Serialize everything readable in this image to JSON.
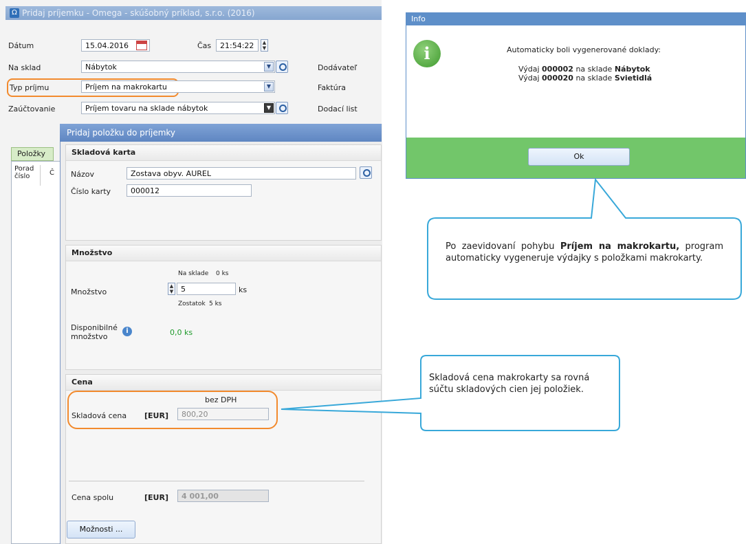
{
  "main": {
    "title": "Pridaj príjemku - Omega - skúšobný príklad, s.r.o. (2016)",
    "date_label": "Dátum",
    "date_value": "15.04.2016",
    "time_label": "Čas",
    "time_value": "21:54:22",
    "warehouse_label": "Na sklad",
    "warehouse_value": "Nábytok",
    "supplier_label": "Dodávateľ",
    "receipt_type_label": "Typ príjmu",
    "receipt_type_value": "Príjem na makrokartu",
    "invoice_label": "Faktúra",
    "posting_label": "Zaúčtovanie",
    "posting_value": "Príjem tovaru na sklade nábytok",
    "delivery_note_label": "Dodací list",
    "tab_items": "Položky",
    "col_order_1": "Porad",
    "col_order_2": "číslo",
    "col_c": "Č"
  },
  "dialog": {
    "title": "Pridaj položku do príjemky",
    "card_section": "Skladová karta",
    "name_label": "Názov",
    "name_value": "Zostava obyv. AUREL",
    "card_no_label": "Číslo karty",
    "card_no_value": "000012",
    "qty_section": "Množstvo",
    "in_stock_label": "Na sklade",
    "in_stock_value": "0 ks",
    "qty_label": "Množstvo",
    "qty_value": "5",
    "qty_unit": "ks",
    "remaining_label": "Zostatok",
    "remaining_value": "5 ks",
    "available_label_1": "Disponibilné",
    "available_label_2": "množstvo",
    "available_value": "0,0 ks",
    "price_section": "Cena",
    "without_vat": "bez DPH",
    "stock_price_label": "Skladová cena",
    "currency": "[EUR]",
    "stock_price_value": "800,20",
    "total_label": "Cena spolu",
    "total_value": "4 001,00",
    "options_button": "Možnosti ..."
  },
  "info": {
    "title": "Info",
    "heading": "Automaticky boli vygenerované doklady:",
    "line1_pre": "Výdaj ",
    "line1_doc": "000002",
    "line1_mid": " na sklade ",
    "line1_wh": "Nábytok",
    "line2_pre": "Výdaj ",
    "line2_doc": "000020",
    "line2_mid": " na sklade ",
    "line2_wh": "Svietidlá",
    "ok_button": "Ok"
  },
  "callouts": {
    "top_pre": "Po zaevidovaní pohybu ",
    "top_bold": "Príjem na makrokartu,",
    "top_post": " program automaticky vygeneruje výdajky s položkami makrokarty.",
    "bottom": "Skladová cena makrokarty sa rovná súčtu skladových cien jej položiek."
  },
  "colors": {
    "highlight": "#f28a2d",
    "callout_border": "#38a8d9",
    "info_footer": "#72c66a",
    "title_bar": "#5e8fc9"
  }
}
